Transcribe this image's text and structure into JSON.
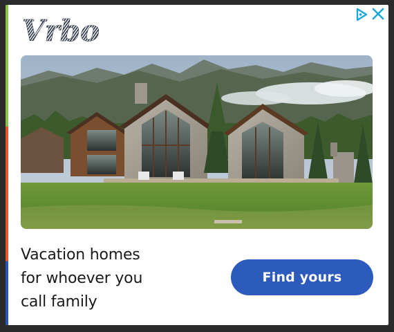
{
  "brand": {
    "logo_text": "Vrbo",
    "logo_color": "#2a3345"
  },
  "ad_controls": {
    "adchoices_icon": "adchoices-triangle-icon",
    "close_icon": "close-x-icon",
    "icon_color": "#1aa7e0"
  },
  "hero_image": {
    "description_icon": "vacation-home-photo"
  },
  "headline": "Vacation homes\nfor whoever you\ncall family",
  "cta": {
    "label": "Find yours",
    "color": "#2d5bbd"
  },
  "accent_stripe": [
    "#8bc34a",
    "#e4572e",
    "#2855b8"
  ]
}
